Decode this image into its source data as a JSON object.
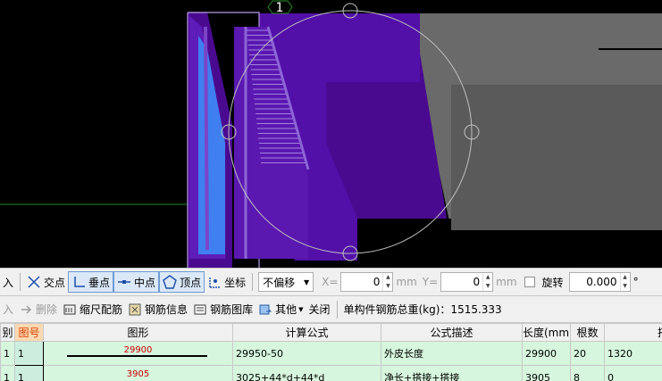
{
  "viewport": {
    "axis_marker": "1",
    "colors": {
      "background": "#000000",
      "purple_main": "#5210a8",
      "purple_dark": "#4a0a90",
      "purple_light": "#7a45c8",
      "blue_face": "#3f7ff0",
      "gray_wall": "#6a6a6a",
      "gray_dark": "#555555",
      "circle": "#c0c0c0",
      "grid_green": "#1e8c1e"
    }
  },
  "snapbar": {
    "truncated_left": "入",
    "intersection": "交点",
    "perpendicular": "垂点",
    "midpoint": "中点",
    "vertex": "顶点",
    "coordinate": "坐标",
    "offset_mode": "不偏移",
    "x_label": "X=",
    "x_value": "0",
    "unit_mm_x": "mm",
    "y_label": "Y=",
    "y_value": "0",
    "unit_mm_y": "mm",
    "rotate_label": "旋转",
    "rotate_value": "0.000",
    "degree": "°"
  },
  "rebarbar": {
    "truncated_left": "入",
    "delete": "删除",
    "scale_rebar": "缩尺配筋",
    "rebar_info": "钢筋信息",
    "rebar_library": "钢筋图库",
    "other": "其他",
    "close": "关闭",
    "total_weight": "单构件钢筋总重(kg)：1515.333"
  },
  "grid": {
    "columns": [
      "别",
      "图号",
      "图形",
      "计算公式",
      "公式描述",
      "长度(mm)",
      "根数",
      "搭接"
    ],
    "rows": [
      {
        "c0": "1",
        "fig_no": "1",
        "shape_value": "29900",
        "formula": "29950-50",
        "description": "外皮长度",
        "length": "29900",
        "count": "20",
        "lap": "1320"
      },
      {
        "c0": "1",
        "fig_no": "1",
        "shape_value": "3905",
        "formula": "3025+44*d+44*d",
        "description": "净长+搭接+搭接",
        "length": "3905",
        "count": "8",
        "lap": "0"
      }
    ]
  }
}
